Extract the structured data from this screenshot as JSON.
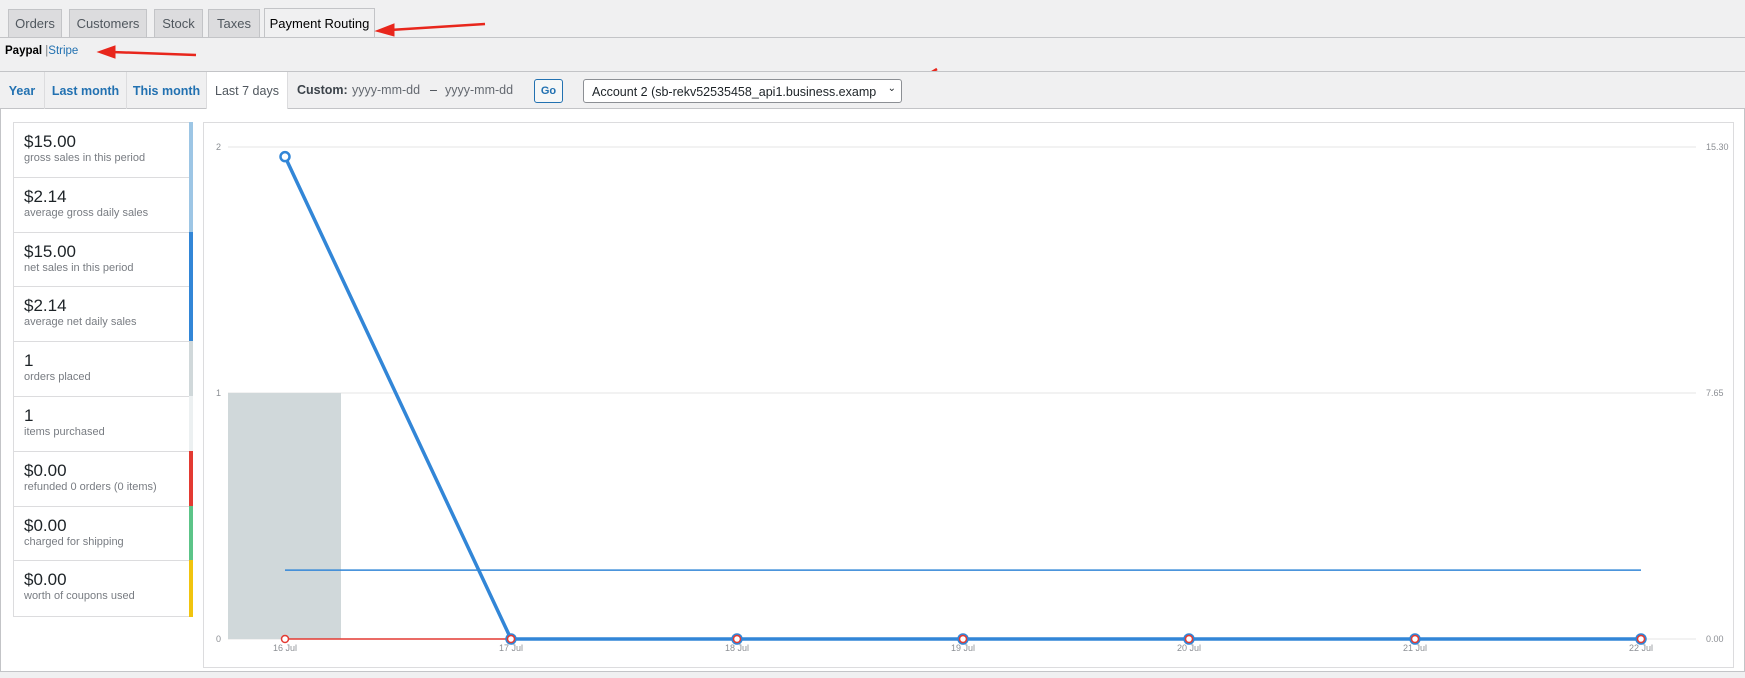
{
  "tabs": [
    {
      "label": "Orders"
    },
    {
      "label": "Customers"
    },
    {
      "label": "Stock"
    },
    {
      "label": "Taxes"
    },
    {
      "label": "Payment Routing",
      "active": true
    }
  ],
  "subnav": {
    "active": "Paypal",
    "separator": "|",
    "other": "Stripe"
  },
  "ranges": [
    {
      "label": "Year"
    },
    {
      "label": "Last month"
    },
    {
      "label": "This month"
    },
    {
      "label": "Last 7 days",
      "active": true
    }
  ],
  "custom": {
    "label": "Custom:",
    "from_placeholder": "yyyy-mm-dd",
    "dash": "–",
    "to_placeholder": "yyyy-mm-dd",
    "go": "Go"
  },
  "account_select": {
    "value": "Account 2 (sb-rekv52535458_api1.business.examp"
  },
  "stats": [
    {
      "value": "$15.00",
      "label": "gross sales in this period",
      "color": "#9dc6e5"
    },
    {
      "value": "$2.14",
      "label": "average gross daily sales",
      "color": "#9dc6e5"
    },
    {
      "value": "$15.00",
      "label": "net sales in this period",
      "color": "#3286d7"
    },
    {
      "value": "$2.14",
      "label": "average net daily sales",
      "color": "#3286d7"
    },
    {
      "value": "1",
      "label": "orders placed",
      "color": "#d0d8da"
    },
    {
      "value": "1",
      "label": "items purchased",
      "color": "#ecf0f1"
    },
    {
      "value": "$0.00",
      "label": "refunded 0 orders (0 items)",
      "color": "#e33a32"
    },
    {
      "value": "$0.00",
      "label": "charged for shipping",
      "color": "#5cc488"
    },
    {
      "value": "$0.00",
      "label": "worth of coupons used",
      "color": "#f1c40f"
    }
  ],
  "chart_data": {
    "type": "line",
    "x": [
      "16 Jul",
      "17 Jul",
      "18 Jul",
      "19 Jul",
      "20 Jul",
      "21 Jul",
      "22 Jul"
    ],
    "left_axis": {
      "ticks": [
        "0",
        "1",
        "2"
      ],
      "range": [
        0,
        2
      ]
    },
    "right_axis": {
      "ticks": [
        "0.00",
        "7.65",
        "15.30"
      ],
      "range": [
        0,
        15.3
      ]
    },
    "series": [
      {
        "name": "orders placed",
        "type": "bar",
        "axis": "left",
        "color": "#d0d8da",
        "values": [
          1,
          0,
          0,
          0,
          0,
          0,
          0
        ]
      },
      {
        "name": "gross sales",
        "type": "line",
        "axis": "right",
        "color": "#3286d7",
        "values": [
          15,
          0,
          0,
          0,
          0,
          0,
          0
        ]
      },
      {
        "name": "average gross daily sales",
        "type": "line",
        "axis": "right",
        "color": "#3286d7",
        "values": [
          2.14,
          2.14,
          2.14,
          2.14,
          2.14,
          2.14,
          2.14
        ]
      },
      {
        "name": "refunds",
        "type": "line",
        "axis": "right",
        "color": "#e33a32",
        "values": [
          0,
          0,
          0,
          0,
          0,
          0,
          0
        ]
      }
    ]
  }
}
